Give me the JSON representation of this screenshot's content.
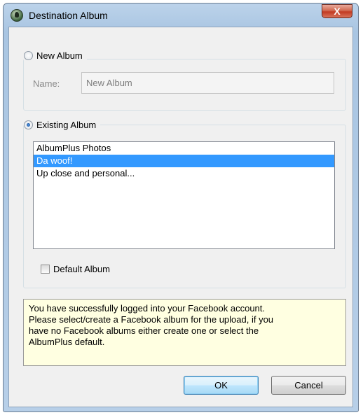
{
  "window": {
    "title": "Destination Album",
    "close_label": "X"
  },
  "new_album": {
    "label": "New Album",
    "selected": false,
    "name_label": "Name:",
    "name_value": "New Album"
  },
  "existing_album": {
    "label": "Existing Album",
    "selected": true,
    "albums": [
      "AlbumPlus Photos",
      "Da woof!",
      "Up close and personal..."
    ],
    "selected_album": "Da woof!",
    "default_album_label": "Default Album",
    "default_album_checked": false
  },
  "info": {
    "lines": [
      "You have successfully logged into your Facebook account.",
      "Please select/create a Facebook album for the upload, if you",
      "have no Facebook albums either create one or select the",
      "AlbumPlus default."
    ]
  },
  "buttons": {
    "ok": "OK",
    "cancel": "Cancel"
  },
  "colors": {
    "selection": "#3399ff",
    "info_background": "#ffffe1",
    "close_button": "#c23a22"
  }
}
